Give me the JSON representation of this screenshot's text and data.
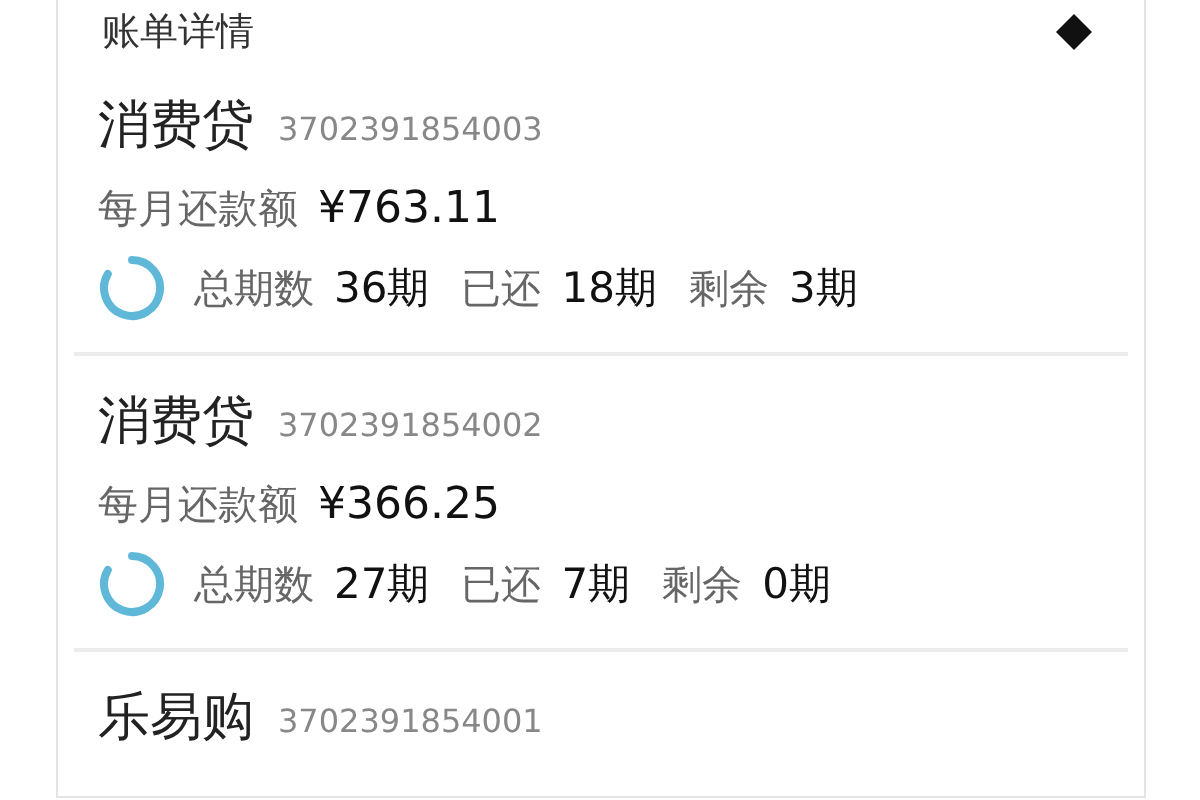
{
  "header": {
    "title": "账单详情"
  },
  "loans": [
    {
      "name": "消费贷",
      "number": "3702391854003",
      "monthly_label": "每月还款额",
      "monthly_amount": "¥763.11",
      "stats": [
        {
          "label": "总期数",
          "value": "36期"
        },
        {
          "label": "已还",
          "value": "18期"
        },
        {
          "label": "剩余",
          "value": "3期"
        }
      ]
    },
    {
      "name": "消费贷",
      "number": "3702391854002",
      "monthly_label": "每月还款额",
      "monthly_amount": "¥366.25",
      "stats": [
        {
          "label": "总期数",
          "value": "27期"
        },
        {
          "label": "已还",
          "value": "7期"
        },
        {
          "label": "剩余",
          "value": "0期"
        }
      ]
    },
    {
      "name": "乐易购",
      "number": "3702391854001"
    }
  ]
}
